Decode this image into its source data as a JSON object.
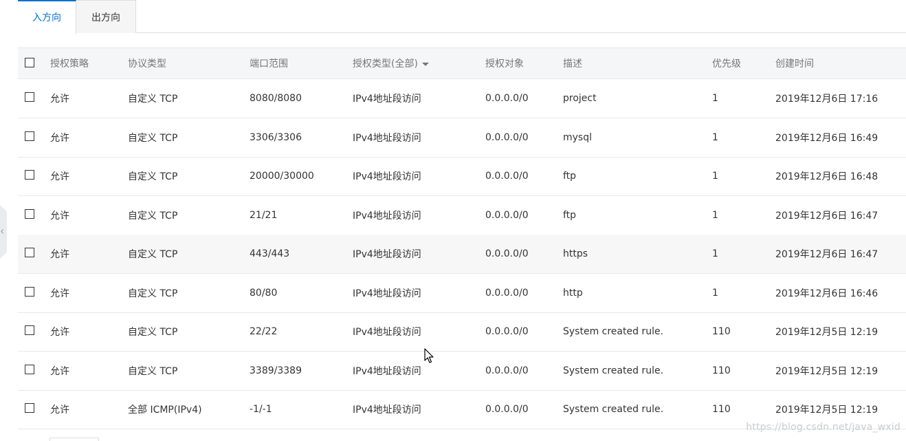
{
  "tabs": [
    {
      "label": "入方向",
      "active": true
    },
    {
      "label": "出方向",
      "active": false
    }
  ],
  "table": {
    "columns": {
      "policy": "授权策略",
      "protocol": "协议类型",
      "port_range": "端口范围",
      "auth_type": "授权类型(全部)",
      "auth_object": "授权对象",
      "description": "描述",
      "priority": "优先级",
      "created": "创建时间"
    },
    "rows": [
      {
        "policy": "允许",
        "protocol": "自定义 TCP",
        "port_range": "8080/8080",
        "auth_type": "IPv4地址段访问",
        "auth_object": "0.0.0.0/0",
        "description": "project",
        "priority": "1",
        "created": "2019年12月6日 17:16"
      },
      {
        "policy": "允许",
        "protocol": "自定义 TCP",
        "port_range": "3306/3306",
        "auth_type": "IPv4地址段访问",
        "auth_object": "0.0.0.0/0",
        "description": "mysql",
        "priority": "1",
        "created": "2019年12月6日 16:49"
      },
      {
        "policy": "允许",
        "protocol": "自定义 TCP",
        "port_range": "20000/30000",
        "auth_type": "IPv4地址段访问",
        "auth_object": "0.0.0.0/0",
        "description": "ftp",
        "priority": "1",
        "created": "2019年12月6日 16:48"
      },
      {
        "policy": "允许",
        "protocol": "自定义 TCP",
        "port_range": "21/21",
        "auth_type": "IPv4地址段访问",
        "auth_object": "0.0.0.0/0",
        "description": "ftp",
        "priority": "1",
        "created": "2019年12月6日 16:47"
      },
      {
        "policy": "允许",
        "protocol": "自定义 TCP",
        "port_range": "443/443",
        "auth_type": "IPv4地址段访问",
        "auth_object": "0.0.0.0/0",
        "description": "https",
        "priority": "1",
        "created": "2019年12月6日 16:47"
      },
      {
        "policy": "允许",
        "protocol": "自定义 TCP",
        "port_range": "80/80",
        "auth_type": "IPv4地址段访问",
        "auth_object": "0.0.0.0/0",
        "description": "http",
        "priority": "1",
        "created": "2019年12月6日 16:46"
      },
      {
        "policy": "允许",
        "protocol": "自定义 TCP",
        "port_range": "22/22",
        "auth_type": "IPv4地址段访问",
        "auth_object": "0.0.0.0/0",
        "description": "System created rule.",
        "priority": "110",
        "created": "2019年12月5日 12:19"
      },
      {
        "policy": "允许",
        "protocol": "自定义 TCP",
        "port_range": "3389/3389",
        "auth_type": "IPv4地址段访问",
        "auth_object": "0.0.0.0/0",
        "description": "System created rule.",
        "priority": "110",
        "created": "2019年12月5日 12:19"
      },
      {
        "policy": "允许",
        "protocol": "全部 ICMP(IPv4)",
        "port_range": "-1/-1",
        "auth_type": "IPv4地址段访问",
        "auth_object": "0.0.0.0/0",
        "description": "System created rule.",
        "priority": "110",
        "created": "2019年12月5日 12:19"
      }
    ]
  },
  "watermark": "https://blog.csdn.net/java_wxid",
  "colors": {
    "accent": "#0070cc",
    "header_bg": "#f5f6f7",
    "hover_row_bg": "#f7f7f7",
    "border": "#e8e8e8"
  },
  "icons": {
    "side_handle": "chevron-left-icon",
    "sort": "caret-down-icon",
    "pointer": "mouse-cursor-icon"
  }
}
